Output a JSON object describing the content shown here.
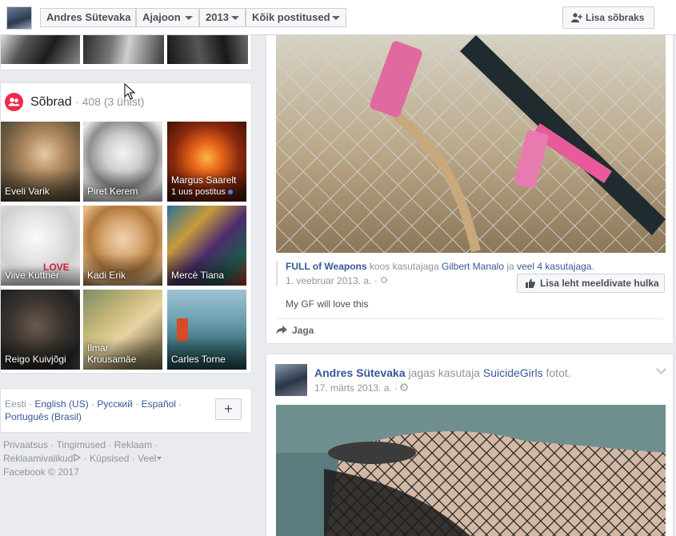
{
  "topbar": {
    "profile_name": "Andres Sütevaka",
    "timeline_label": "Ajajoon",
    "year_label": "2013",
    "filter_label": "Kõik postitused",
    "add_friend_label": "Lisa sõbraks"
  },
  "friends": {
    "title": "Sõbrad",
    "count": "· 408 (3 ühist)",
    "tiles": [
      {
        "name": "Eveli Varik"
      },
      {
        "name": "Piret Kerem"
      },
      {
        "name": "Margus Saarelt",
        "sub": "1 uus postitus"
      },
      {
        "name": "Viive Küttner"
      },
      {
        "name": "Kadi Erik"
      },
      {
        "name": "Mercè Tiana"
      },
      {
        "name": "Reigo Kuivjõgi"
      },
      {
        "name": "Ilmar",
        "name2": "Kruusamäe"
      },
      {
        "name": "Carles Torne"
      }
    ],
    "love_text": "LOVE"
  },
  "languages": {
    "current": "Eesti",
    "links": [
      "English (US)",
      "Русский",
      "Español",
      "Português (Brasil)"
    ],
    "plus": "+"
  },
  "footer": {
    "links": [
      "Privaatsus",
      "Tingimused",
      "Reklaam",
      "Reklaamivalikud",
      "Küpsised",
      "Veel"
    ],
    "copyright": "Facebook © 2017"
  },
  "post1": {
    "page_name": "FULL of Weapons",
    "with_text": "koos kasutajaga",
    "tagged": "Gilbert Manalo",
    "and_text": "ja",
    "more": "veel 4 kasutajaga",
    "date": "1. veebruar 2013. a. ·",
    "like_page_label": "Lisa leht meeldivate hulka",
    "caption": "My GF will love this",
    "share_label": "Jaga"
  },
  "post2": {
    "author": "Andres Sütevaka",
    "action": "jagas kasutaja",
    "page": "SuicideGirls",
    "object": "fotot.",
    "date": "17. märts 2013. a. ·"
  },
  "colors": {
    "link": "#365899",
    "friends_icon": "#f02849",
    "online_dot": "#4080ff"
  }
}
